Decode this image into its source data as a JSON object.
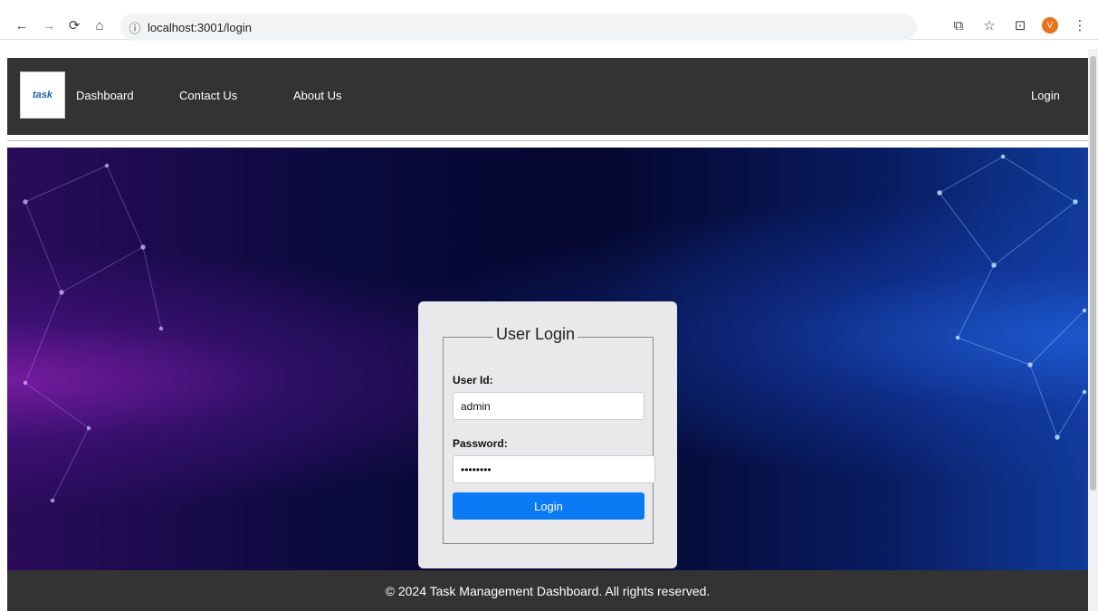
{
  "browser": {
    "url": "localhost:3001/login",
    "avatar_letter": "V"
  },
  "navbar": {
    "logo_text": "task",
    "links": [
      "Dashboard",
      "Contact Us",
      "About Us"
    ],
    "login_link": "Login"
  },
  "login_form": {
    "title": "User Login",
    "user_id_label": "User Id:",
    "user_id_value": "admin",
    "password_label": "Password:",
    "password_value": "••••••••",
    "submit_label": "Login"
  },
  "footer": {
    "text": "© 2024 Task Management Dashboard. All rights reserved."
  },
  "colors": {
    "navbar_bg": "#333333",
    "button_blue": "#0a7bf5",
    "card_bg": "#e9e9ec",
    "avatar_orange": "#e8711c"
  },
  "icons": [
    "back-arrow-icon",
    "forward-arrow-icon",
    "reload-icon",
    "home-icon",
    "info-icon",
    "cast-icon",
    "star-icon",
    "extensions-icon",
    "menu-dots-icon"
  ]
}
